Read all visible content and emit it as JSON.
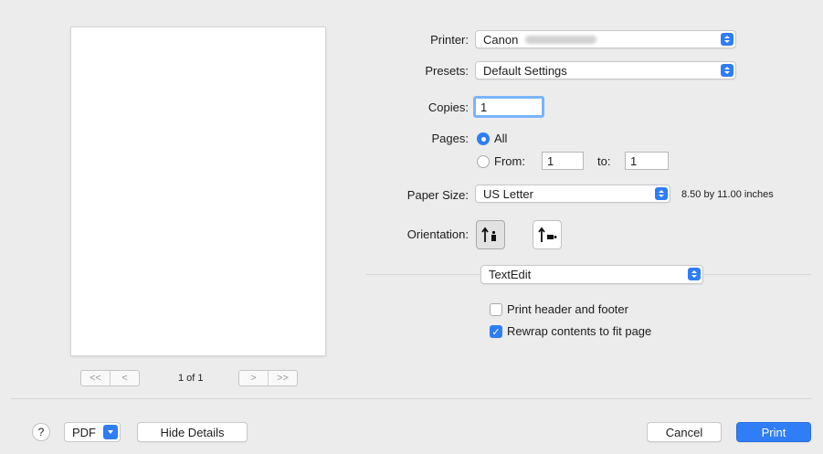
{
  "preview": {
    "page_indicator": "1 of 1",
    "nav": {
      "first": "<<",
      "prev": "<",
      "next": ">",
      "last": ">>"
    }
  },
  "printer": {
    "label": "Printer:",
    "value": "Canon"
  },
  "presets": {
    "label": "Presets:",
    "value": "Default Settings"
  },
  "copies": {
    "label": "Copies:",
    "value": "1"
  },
  "pages": {
    "label": "Pages:",
    "all": "All",
    "from": "From:",
    "from_value": "1",
    "to": "to:",
    "to_value": "1",
    "selected": "All"
  },
  "paper_size": {
    "label": "Paper Size:",
    "value": "US Letter",
    "dimensions": "8.50 by 11.00 inches"
  },
  "orientation": {
    "label": "Orientation:",
    "selected": "portrait"
  },
  "app_popup": {
    "value": "TextEdit"
  },
  "options": {
    "header_footer": "Print header and footer",
    "header_footer_checked": false,
    "rewrap": "Rewrap contents to fit page",
    "rewrap_checked": true
  },
  "footer": {
    "help": "?",
    "pdf": "PDF",
    "hide_details": "Hide Details",
    "cancel": "Cancel",
    "print": "Print"
  },
  "colors": {
    "accent": "#2f7df7",
    "background": "#ececec"
  }
}
